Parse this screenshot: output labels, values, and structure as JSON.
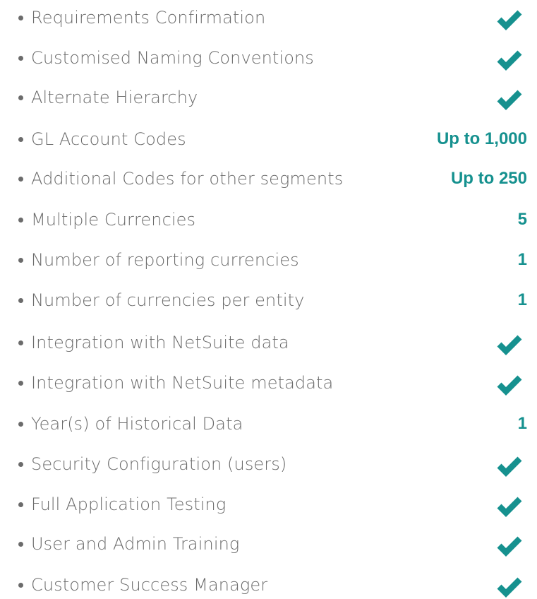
{
  "accent_color": "#16918f",
  "text_color": "#6b6b6b",
  "items": [
    {
      "label": "Requirements Confirmation",
      "value": "",
      "check": true
    },
    {
      "label": "Customised Naming Conventions",
      "value": "",
      "check": true
    },
    {
      "label": "Alternate Hierarchy",
      "value": "",
      "check": true
    },
    {
      "label": "GL Account Codes",
      "value": "Up to 1,000",
      "check": false
    },
    {
      "label": "Additional Codes for other segments",
      "value": "Up to 250",
      "check": false
    },
    {
      "label": "Multiple Currencies",
      "value": "5",
      "check": false
    },
    {
      "label": "Number of reporting currencies",
      "value": "1",
      "check": false
    },
    {
      "label": "Number of currencies per entity",
      "value": "1",
      "check": false
    },
    {
      "label": "Integration with NetSuite data",
      "value": "",
      "check": true
    },
    {
      "label": "Integration with NetSuite metadata",
      "value": "",
      "check": true
    },
    {
      "label": "Year(s) of Historical Data",
      "value": "1",
      "check": false
    },
    {
      "label": "Security Configuration (users)",
      "value": "",
      "check": true
    },
    {
      "label": "Full Application Testing",
      "value": "",
      "check": true
    },
    {
      "label": "User and Admin Training",
      "value": "",
      "check": true
    },
    {
      "label": "Customer Success Manager",
      "value": "",
      "check": true
    }
  ]
}
